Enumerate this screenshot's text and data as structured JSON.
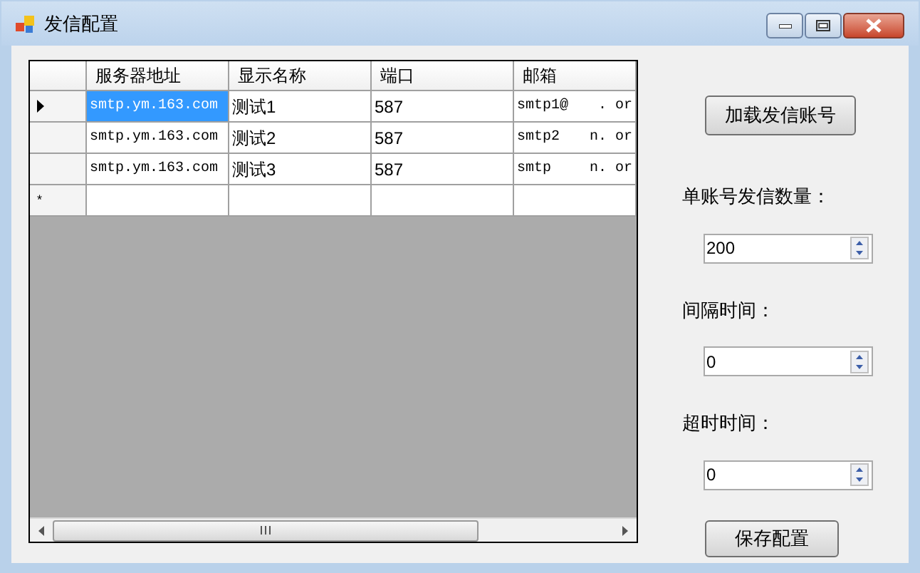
{
  "window": {
    "title": "发信配置"
  },
  "table": {
    "columns": [
      "服务器地址",
      "显示名称",
      "端口",
      "邮箱"
    ],
    "rows": [
      {
        "current": true,
        "server_selected": true,
        "server": "smtp.ym.163.com",
        "name": "测试1",
        "port": "587",
        "email_start": "smtp1@",
        "email_end": ". or"
      },
      {
        "current": false,
        "server_selected": false,
        "server": "smtp.ym.163.com",
        "name": "测试2",
        "port": "587",
        "email_start": "smtp2",
        "email_end": "n. or"
      },
      {
        "current": false,
        "server_selected": false,
        "server": "smtp.ym.163.com",
        "name": "测试3",
        "port": "587",
        "email_start": "smtp",
        "email_end": "n. or"
      }
    ],
    "new_row_marker": "*"
  },
  "load_button": "加载发信账号",
  "fields": [
    {
      "label": "单账号发信数量：",
      "value": "200"
    },
    {
      "label": "间隔时间：",
      "value": "0"
    },
    {
      "label": "超时时间：",
      "value": "0"
    }
  ],
  "save_button": "保存配置"
}
